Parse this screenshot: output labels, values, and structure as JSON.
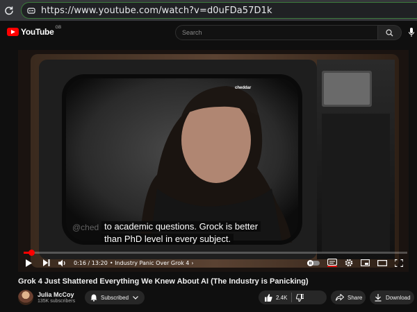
{
  "browser": {
    "url": "https://www.youtube.com/watch?v=d0uFDa57D1k"
  },
  "header": {
    "logo_text": "YouTube",
    "country_code": "GB",
    "search_placeholder": "Search"
  },
  "player": {
    "subtitle_line1": "to academic questions. Grock is better",
    "subtitle_line2": "than PhD level in every subject.",
    "watermark": "@ched",
    "channel_bug": "cheddar",
    "progress_fraction": 0.02,
    "time": "0:16 / 13:20",
    "chapter": "• Industry Panic Over Grok 4",
    "chapter_chevron": "›"
  },
  "video": {
    "title": "Grok 4 Just Shattered Everything We Knew About AI (The Industry is Panicking)"
  },
  "owner": {
    "channel_name": "Julia McCoy",
    "subscribers": "135K subscribers",
    "subscribe_label": "Subscribed",
    "like_count": "2.4K",
    "share_label": "Share",
    "download_label": "Download"
  },
  "colors": {
    "accent": "#ff0000",
    "background": "#0f0f0f"
  }
}
